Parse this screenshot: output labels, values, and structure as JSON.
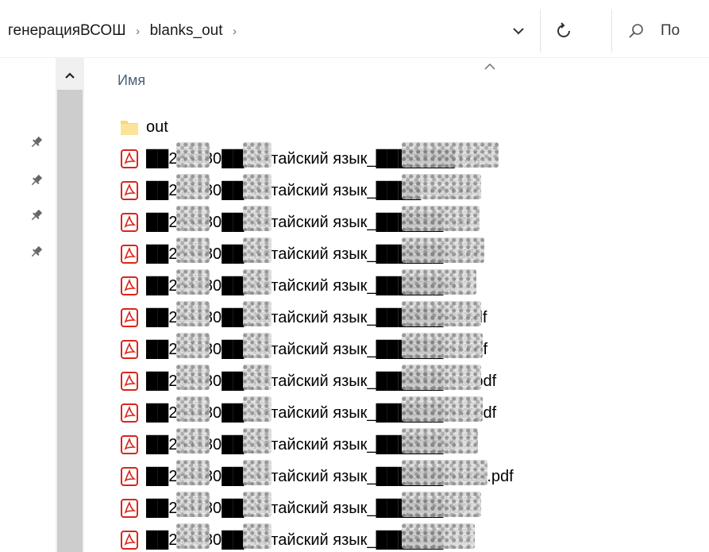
{
  "address": {
    "crumbs": [
      "генерацияВСОШ",
      "blanks_out"
    ],
    "separator": "›",
    "search_placeholder": "По"
  },
  "icons": {
    "dropdown": "chevron-down-icon",
    "refresh": "refresh-icon",
    "search": "search-icon",
    "pin": "pin-icon",
    "folder": "folder-icon",
    "pdf": "pdf-icon"
  },
  "colors": {
    "header_text": "#4c607a",
    "pdf_red": "#d9261c",
    "folder_yellow": "#f8d775"
  },
  "list": {
    "column_name": "Имя",
    "rows": [
      {
        "type": "folder",
        "name": "out"
      },
      {
        "type": "pdf",
        "name": "██283680██_Китайский язык_███████.pdf"
      },
      {
        "type": "pdf",
        "name": "██283780██_Китайский язык_████ева.pdf"
      },
      {
        "type": "pdf",
        "name": "██283880██_Китайский язык_██████.pdf"
      },
      {
        "type": "pdf",
        "name": "██283980██_Китайский язык_██████а.pdf"
      },
      {
        "type": "pdf",
        "name": "██284080██_Китайский язык_██████df"
      },
      {
        "type": "pdf",
        "name": "██284180██_Китайский язык_██████ва.pdf"
      },
      {
        "type": "pdf",
        "name": "██284280██_Китайский язык_██████ин.pdf"
      },
      {
        "type": "pdf",
        "name": "██284380██_Китайский язык_██████ина.pdf"
      },
      {
        "type": "pdf",
        "name": "██284480██_Китайский язык_██████ина.pdf"
      },
      {
        "type": "pdf",
        "name": "██284580██_Китайский язык_██████df"
      },
      {
        "type": "pdf",
        "name": "██284680██_Китайский язык_██████инова.pdf"
      },
      {
        "type": "pdf",
        "name": "██284780██_Китайский язык_██████pdf"
      },
      {
        "type": "pdf",
        "name": "██284880██_Китайский язык_██████"
      }
    ]
  }
}
